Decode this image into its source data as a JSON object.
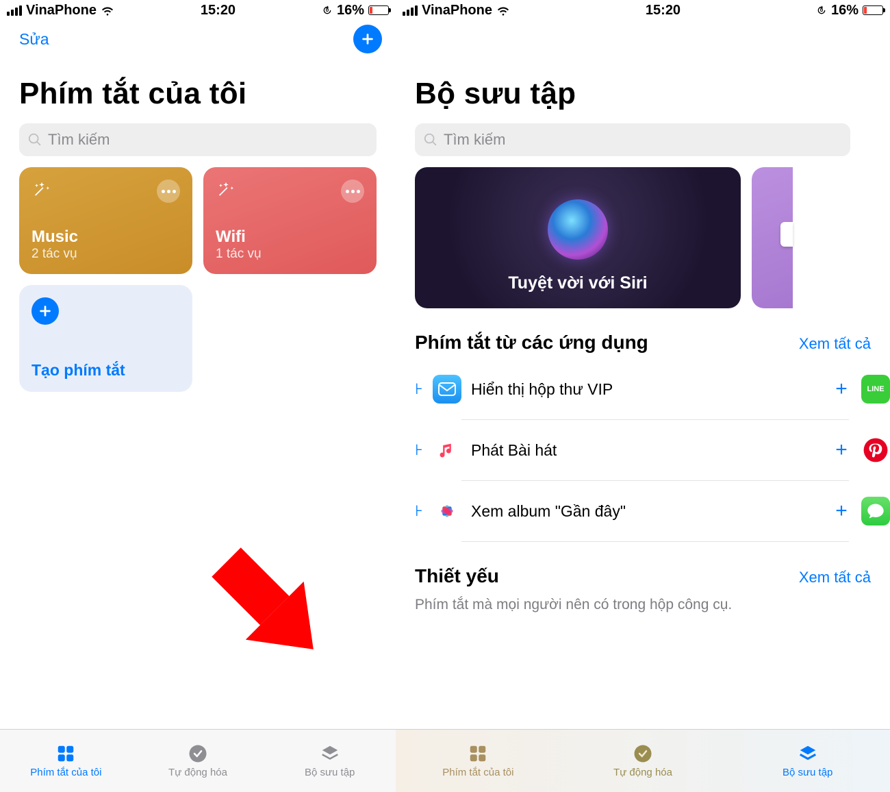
{
  "status": {
    "carrier": "VinaPhone",
    "time": "15:20",
    "battery_pct": "16%"
  },
  "left": {
    "edit": "Sửa",
    "title": "Phím tắt của tôi",
    "search_placeholder": "Tìm kiếm",
    "cards": [
      {
        "name": "Music",
        "sub": "2 tác vụ"
      },
      {
        "name": "Wifi",
        "sub": "1 tác vụ"
      }
    ],
    "create_label": "Tạo phím tắt",
    "tabs": [
      "Phím tắt của tôi",
      "Tự động hóa",
      "Bộ sưu tập"
    ]
  },
  "right": {
    "title": "Bộ sưu tập",
    "search_placeholder": "Tìm kiếm",
    "hero_caption": "Tuyệt vời với Siri",
    "section1_title": "Phím tắt từ các ứng dụng",
    "see_all": "Xem tất cả",
    "rows": [
      {
        "label": "Hiển thị hộp thư VIP"
      },
      {
        "label": "Phát Bài hát"
      },
      {
        "label": "Xem album \"Gần đây\""
      }
    ],
    "section2_title": "Thiết yếu",
    "section2_sub": "Phím tắt mà mọi người nên có trong hộp công cụ.",
    "tabs": [
      "Phím tắt của tôi",
      "Tự động hóa",
      "Bộ sưu tập"
    ]
  }
}
